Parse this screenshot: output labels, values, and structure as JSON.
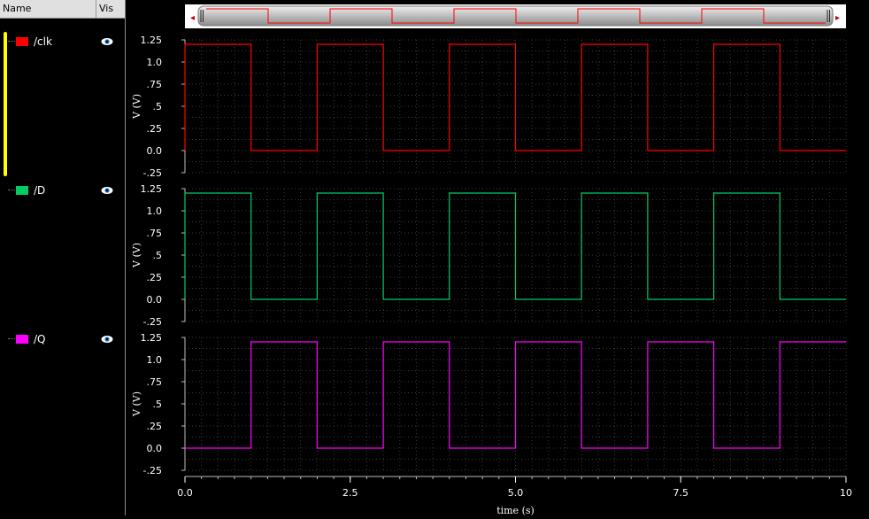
{
  "sidebar": {
    "header_name": "Name",
    "header_vis": "Vis",
    "signals": [
      {
        "label": "/clk",
        "color": "#ff0000",
        "icon": "eye-icon"
      },
      {
        "label": "/D",
        "color": "#00cc66",
        "icon": "eye-icon"
      },
      {
        "label": "/Q",
        "color": "#ff00ff",
        "icon": "eye-icon"
      }
    ]
  },
  "scrollbar": {
    "left_arrow": "◂",
    "right_arrow": "▸"
  },
  "chart_data": {
    "type": "line",
    "xlabel": "time (s)",
    "xlim": [
      0,
      10
    ],
    "xticks": [
      "0.0",
      "2.5",
      "5.0",
      "7.5",
      "10"
    ],
    "ylabel": "V (V)",
    "ylim": [
      -0.25,
      1.25
    ],
    "yticks": [
      "1.25",
      "1.0",
      ".75",
      ".5",
      ".25",
      "0.0",
      "-.25"
    ],
    "grid": true,
    "series": [
      {
        "name": "/clk",
        "color": "#ff0000",
        "x": [
          0,
          1,
          2,
          3,
          4,
          5,
          6,
          7,
          8,
          9,
          10
        ],
        "y": [
          1.2,
          0,
          1.2,
          0,
          1.2,
          0,
          1.2,
          0,
          1.2,
          0,
          0
        ]
      },
      {
        "name": "/D",
        "color": "#00cc66",
        "x": [
          0,
          1,
          2,
          3,
          4,
          5,
          6,
          7,
          8,
          9,
          10
        ],
        "y": [
          1.2,
          0,
          1.2,
          0,
          1.2,
          0,
          1.2,
          0,
          1.2,
          0,
          0
        ]
      },
      {
        "name": "/Q",
        "color": "#ff00ff",
        "x": [
          0,
          1,
          2,
          3,
          4,
          5,
          6,
          7,
          8,
          9,
          10
        ],
        "y": [
          0,
          1.2,
          0,
          1.2,
          0,
          1.2,
          0,
          1.2,
          0,
          1.2,
          1.2
        ]
      }
    ]
  }
}
